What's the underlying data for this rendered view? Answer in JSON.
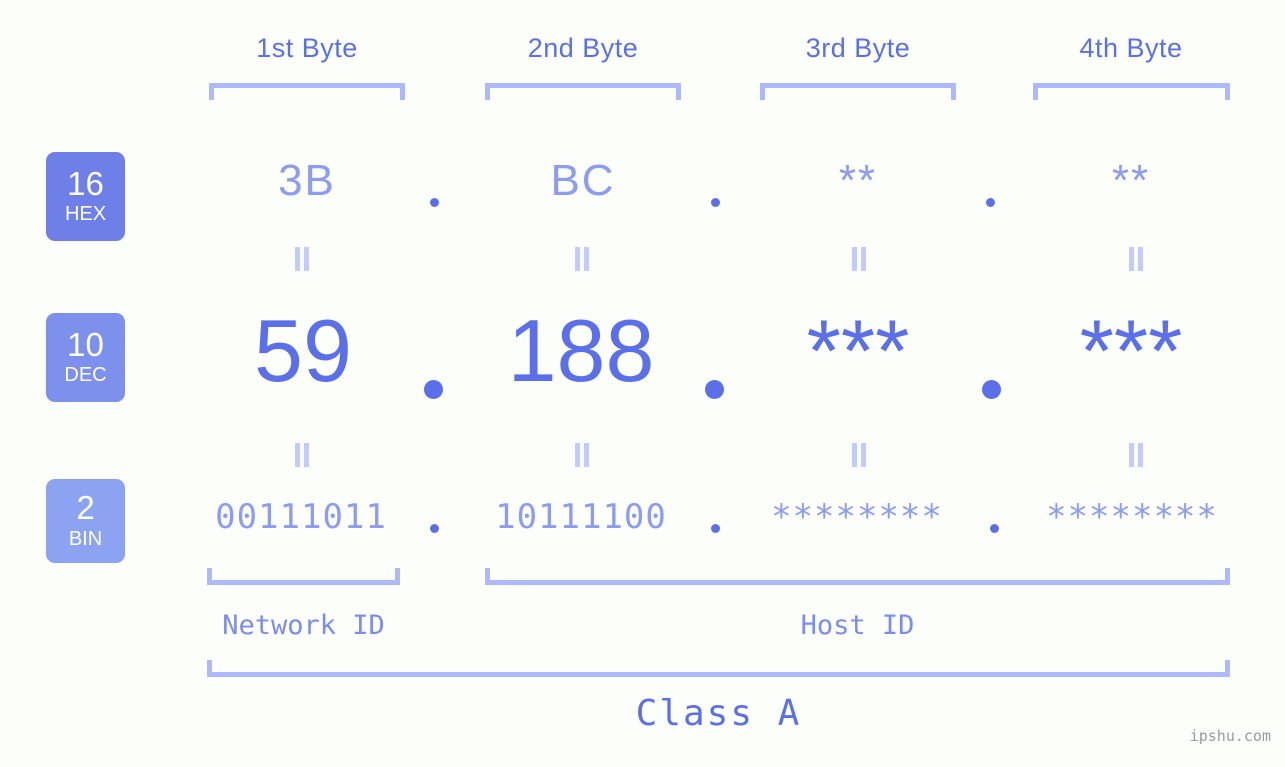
{
  "background_color": "#fcfefa",
  "accent_color": "#5b6fe8",
  "accent_light_color": "#8c9cf2",
  "bracket_color": "#aeb9fb",
  "byte_headers": [
    {
      "label": "1st Byte"
    },
    {
      "label": "2nd Byte"
    },
    {
      "label": "3rd Byte"
    },
    {
      "label": "4th Byte"
    }
  ],
  "bases": [
    {
      "radix": "16",
      "name": "HEX",
      "color": "#6f7fe8"
    },
    {
      "radix": "10",
      "name": "DEC",
      "color": "#7d90ec"
    },
    {
      "radix": "2",
      "name": "BIN",
      "color": "#8ba3f0"
    }
  ],
  "rows": {
    "hex": {
      "values": [
        "3B",
        "BC",
        "**",
        "**"
      ],
      "separator": "."
    },
    "dec": {
      "values": [
        "59",
        "188",
        "***",
        "***"
      ],
      "separator": "."
    },
    "bin": {
      "values": [
        "00111011",
        "10111100",
        "********",
        "********"
      ],
      "separator": "."
    }
  },
  "equality_symbol": "=",
  "sections": [
    {
      "label": "Network ID",
      "bytes": "1"
    },
    {
      "label": "Host ID",
      "bytes": "2-4"
    }
  ],
  "class": {
    "label": "Class A"
  },
  "watermark": {
    "text": "ipshu.com"
  }
}
